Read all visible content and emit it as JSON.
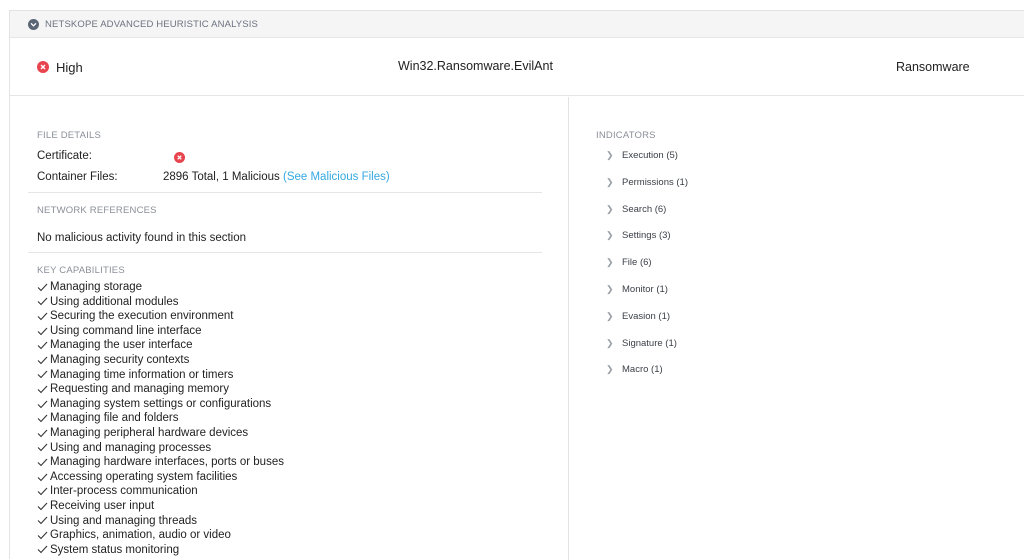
{
  "header": {
    "title": "NETSKOPE ADVANCED HEURISTIC ANALYSIS",
    "icon": "chevron-down-circle-icon"
  },
  "summary": {
    "severity": "High",
    "severity_icon": "error-circle-icon",
    "severity_color": "#e8444d",
    "threat_name": "Win32.Ransomware.EvilAnt",
    "threat_type": "Ransomware"
  },
  "file_details": {
    "section_title": "FILE DETAILS",
    "certificate_label": "Certificate:",
    "certificate_status_icon": "error-circle-icon",
    "container_files_label": "Container Files:",
    "container_files_value": "2896 Total, 1 Malicious",
    "container_files_link": "(See Malicious Files)",
    "link_color": "#35a8e0"
  },
  "network_references": {
    "section_title": "NETWORK REFERENCES",
    "message": "No malicious activity found in this section"
  },
  "key_capabilities": {
    "section_title": "KEY CAPABILITIES",
    "items": [
      "Managing storage",
      "Using additional modules",
      "Securing the execution environment",
      "Using command line interface",
      "Managing the user interface",
      "Managing security contexts",
      "Managing time information or timers",
      "Requesting and managing memory",
      "Managing system settings or configurations",
      "Managing file and folders",
      "Managing peripheral hardware devices",
      "Using and managing processes",
      "Managing hardware interfaces, ports or buses",
      "Accessing operating system facilities",
      "Inter-process communication",
      "Receiving user input",
      "Using and managing threads",
      "Graphics, animation, audio or video",
      "System status monitoring"
    ]
  },
  "indicators": {
    "section_title": "INDICATORS",
    "items": [
      "Execution (5)",
      "Permissions (1)",
      "Search (6)",
      "Settings (3)",
      "File (6)",
      "Monitor (1)",
      "Evasion (1)",
      "Signature (1)",
      "Macro (1)"
    ]
  }
}
